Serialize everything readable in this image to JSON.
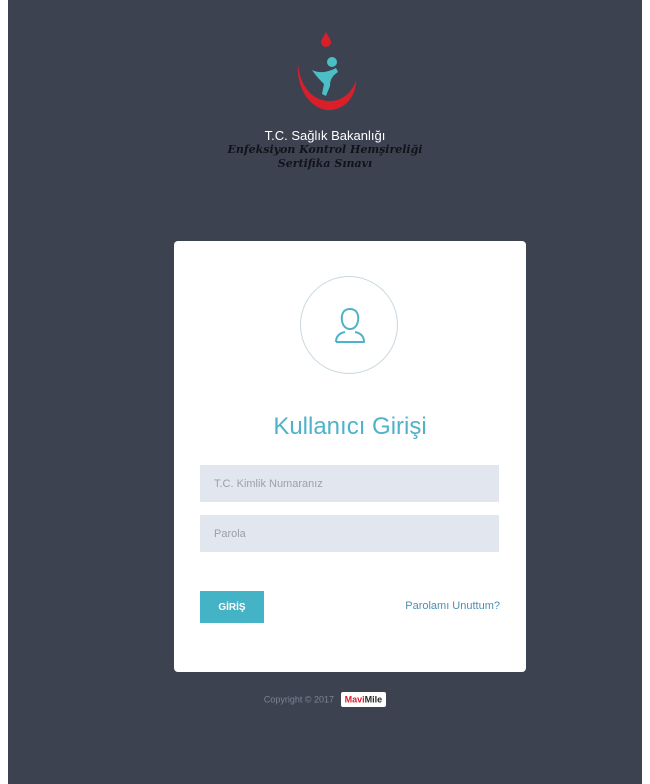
{
  "header": {
    "ministry": "T.C. Sağlık Bakanlığı",
    "exam_line1": "Enfeksiyon Kontrol Hemşireliği",
    "exam_line2": "Sertifika Sınavı"
  },
  "login": {
    "title": "Kullanıcı Girişi",
    "tc_placeholder": "T.C. Kimlik Numaranız",
    "password_placeholder": "Parola",
    "submit_label": "GİRİŞ",
    "forgot_label": "Parolamı Unuttum?"
  },
  "footer": {
    "copyright": "Copyright © 2017",
    "brand_part1": "Mavi",
    "brand_part2": "Mile"
  },
  "colors": {
    "page_bg": "#3d4251",
    "accent": "#44b3c6",
    "logo_red": "#d81f2a",
    "logo_teal": "#4bbfc5"
  },
  "icons": {
    "logo": "ministry-logo-icon",
    "avatar": "user-icon"
  }
}
